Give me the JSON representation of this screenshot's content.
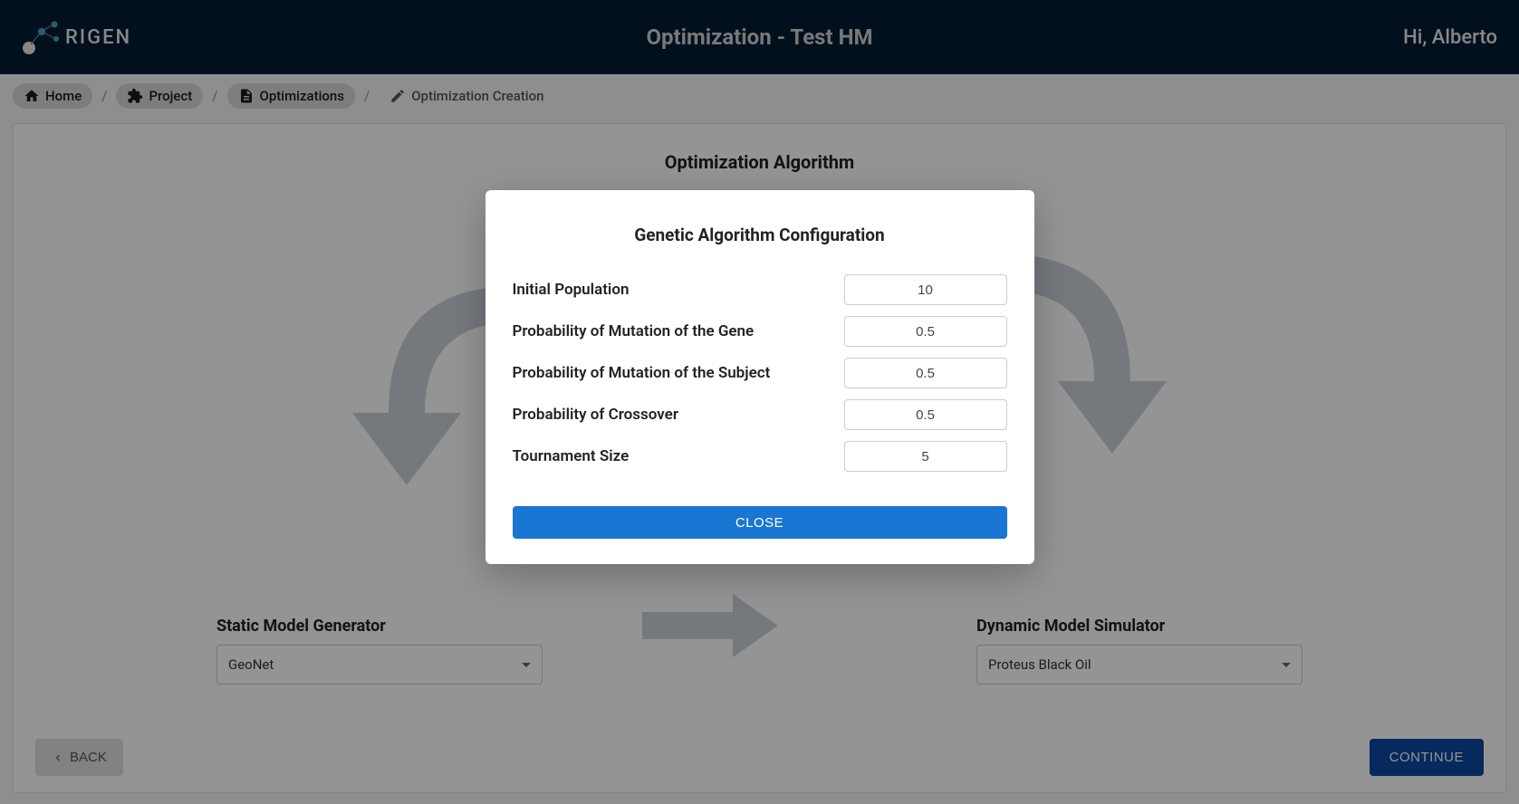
{
  "header": {
    "logo_text": "RIGEN",
    "title": "Optimization - Test HM",
    "greeting": "Hi, Alberto"
  },
  "breadcrumb": {
    "home": "Home",
    "project": "Project",
    "optimizations": "Optimizations",
    "current": "Optimization Creation"
  },
  "main": {
    "algo_title": "Optimization Algorithm",
    "static_label": "Static Model Generator",
    "static_value": "GeoNet",
    "dynamic_label": "Dynamic Model Simulator",
    "dynamic_value": "Proteus Black Oil",
    "back": "BACK",
    "continue": "CONTINUE"
  },
  "modal": {
    "title": "Genetic Algorithm Configuration",
    "fields": [
      {
        "label": "Initial Population",
        "value": "10"
      },
      {
        "label": "Probability of Mutation of the Gene",
        "value": "0.5"
      },
      {
        "label": "Probability of Mutation of the Subject",
        "value": "0.5"
      },
      {
        "label": "Probability of Crossover",
        "value": "0.5"
      },
      {
        "label": "Tournament Size",
        "value": "5"
      }
    ],
    "close": "CLOSE"
  }
}
